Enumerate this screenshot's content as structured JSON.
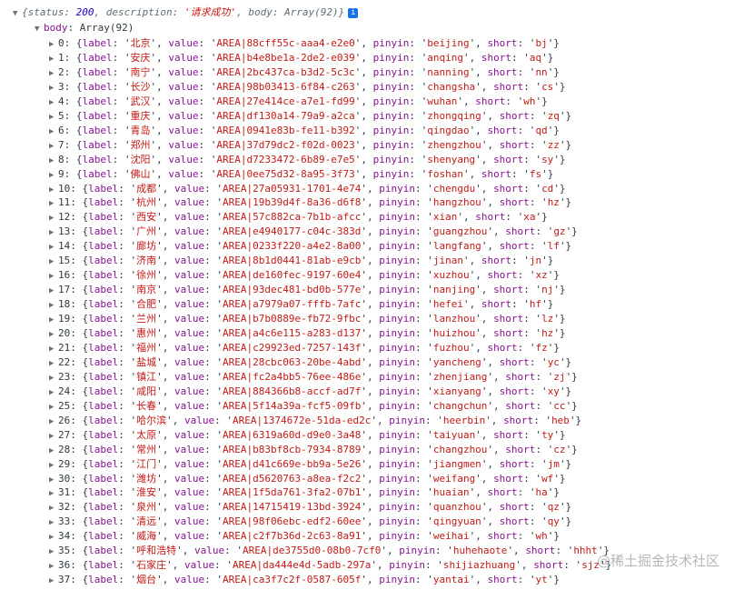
{
  "console": {
    "summary_open": "{status: ",
    "summary_status": "200",
    "summary_mid": ", description: ",
    "summary_description": "'请求成功'",
    "summary_tail": ", body: Array(92)}",
    "info_icon": "i",
    "body_label": "body",
    "body_value": "Array(92)"
  },
  "rows": [
    {
      "i": "0",
      "label": "北京",
      "value": "AREA|88cff55c-aaa4-e2e0",
      "pinyin": "beijing",
      "short": "bj"
    },
    {
      "i": "1",
      "label": "安庆",
      "value": "AREA|b4e8be1a-2de2-e039",
      "pinyin": "anqing",
      "short": "aq"
    },
    {
      "i": "2",
      "label": "南宁",
      "value": "AREA|2bc437ca-b3d2-5c3c",
      "pinyin": "nanning",
      "short": "nn"
    },
    {
      "i": "3",
      "label": "长沙",
      "value": "AREA|98b03413-6f84-c263",
      "pinyin": "changsha",
      "short": "cs"
    },
    {
      "i": "4",
      "label": "武汉",
      "value": "AREA|27e414ce-a7e1-fd99",
      "pinyin": "wuhan",
      "short": "wh"
    },
    {
      "i": "5",
      "label": "重庆",
      "value": "AREA|df130a14-79a9-a2ca",
      "pinyin": "zhongqing",
      "short": "zq"
    },
    {
      "i": "6",
      "label": "青岛",
      "value": "AREA|0941e83b-fe11-b392",
      "pinyin": "qingdao",
      "short": "qd"
    },
    {
      "i": "7",
      "label": "郑州",
      "value": "AREA|37d79dc2-f02d-0023",
      "pinyin": "zhengzhou",
      "short": "zz"
    },
    {
      "i": "8",
      "label": "沈阳",
      "value": "AREA|d7233472-6b89-e7e5",
      "pinyin": "shenyang",
      "short": "sy"
    },
    {
      "i": "9",
      "label": "佛山",
      "value": "AREA|0ee75d32-8a95-3f73",
      "pinyin": "foshan",
      "short": "fs"
    },
    {
      "i": "10",
      "label": "成都",
      "value": "AREA|27a05931-1701-4e74",
      "pinyin": "chengdu",
      "short": "cd"
    },
    {
      "i": "11",
      "label": "杭州",
      "value": "AREA|19b39d4f-8a36-d6f8",
      "pinyin": "hangzhou",
      "short": "hz"
    },
    {
      "i": "12",
      "label": "西安",
      "value": "AREA|57c882ca-7b1b-afcc",
      "pinyin": "xian",
      "short": "xa"
    },
    {
      "i": "13",
      "label": "广州",
      "value": "AREA|e4940177-c04c-383d",
      "pinyin": "guangzhou",
      "short": "gz"
    },
    {
      "i": "14",
      "label": "廊坊",
      "value": "AREA|0233f220-a4e2-8a00",
      "pinyin": "langfang",
      "short": "lf"
    },
    {
      "i": "15",
      "label": "济南",
      "value": "AREA|8b1d0441-81ab-e9cb",
      "pinyin": "jinan",
      "short": "jn"
    },
    {
      "i": "16",
      "label": "徐州",
      "value": "AREA|de160fec-9197-60e4",
      "pinyin": "xuzhou",
      "short": "xz"
    },
    {
      "i": "17",
      "label": "南京",
      "value": "AREA|93dec481-bd0b-577e",
      "pinyin": "nanjing",
      "short": "nj"
    },
    {
      "i": "18",
      "label": "合肥",
      "value": "AREA|a7979a07-fffb-7afc",
      "pinyin": "hefei",
      "short": "hf"
    },
    {
      "i": "19",
      "label": "兰州",
      "value": "AREA|b7b0889e-fb72-9fbc",
      "pinyin": "lanzhou",
      "short": "lz"
    },
    {
      "i": "20",
      "label": "惠州",
      "value": "AREA|a4c6e115-a283-d137",
      "pinyin": "huizhou",
      "short": "hz"
    },
    {
      "i": "21",
      "label": "福州",
      "value": "AREA|c29923ed-7257-143f",
      "pinyin": "fuzhou",
      "short": "fz"
    },
    {
      "i": "22",
      "label": "盐城",
      "value": "AREA|28cbc063-20be-4abd",
      "pinyin": "yancheng",
      "short": "yc"
    },
    {
      "i": "23",
      "label": "镇江",
      "value": "AREA|fc2a4bb5-76ee-486e",
      "pinyin": "zhenjiang",
      "short": "zj"
    },
    {
      "i": "24",
      "label": "咸阳",
      "value": "AREA|884366b8-accf-ad7f",
      "pinyin": "xianyang",
      "short": "xy"
    },
    {
      "i": "25",
      "label": "长春",
      "value": "AREA|5f14a39a-fcf5-09fb",
      "pinyin": "changchun",
      "short": "cc"
    },
    {
      "i": "26",
      "label": "哈尔滨",
      "value": "AREA|1374672e-51da-ed2c",
      "pinyin": "heerbin",
      "short": "heb"
    },
    {
      "i": "27",
      "label": "太原",
      "value": "AREA|6319a60d-d9e0-3a48",
      "pinyin": "taiyuan",
      "short": "ty"
    },
    {
      "i": "28",
      "label": "常州",
      "value": "AREA|b83bf8cb-7934-8789",
      "pinyin": "changzhou",
      "short": "cz"
    },
    {
      "i": "29",
      "label": "江门",
      "value": "AREA|d41c669e-bb9a-5e26",
      "pinyin": "jiangmen",
      "short": "jm"
    },
    {
      "i": "30",
      "label": "潍坊",
      "value": "AREA|d5620763-a8ea-f2c2",
      "pinyin": "weifang",
      "short": "wf"
    },
    {
      "i": "31",
      "label": "淮安",
      "value": "AREA|1f5da761-3fa2-07b1",
      "pinyin": "huaian",
      "short": "ha"
    },
    {
      "i": "32",
      "label": "泉州",
      "value": "AREA|14715419-13bd-3924",
      "pinyin": "quanzhou",
      "short": "qz"
    },
    {
      "i": "33",
      "label": "清远",
      "value": "AREA|98f06ebc-edf2-60ee",
      "pinyin": "qingyuan",
      "short": "qy"
    },
    {
      "i": "34",
      "label": "威海",
      "value": "AREA|c2f7b36d-2c63-8a91",
      "pinyin": "weihai",
      "short": "wh"
    },
    {
      "i": "35",
      "label": "呼和浩特",
      "value": "AREA|de3755d0-08b0-7cf0",
      "pinyin": "huhehaote",
      "short": "hhht"
    },
    {
      "i": "36",
      "label": "石家庄",
      "value": "AREA|da444e4d-5adb-297a",
      "pinyin": "shijiazhuang",
      "short": "sjz"
    },
    {
      "i": "37",
      "label": "烟台",
      "value": "AREA|ca3f7c2f-0587-605f",
      "pinyin": "yantai",
      "short": "yt"
    }
  ],
  "watermark": "@稀土掘金技术社区"
}
